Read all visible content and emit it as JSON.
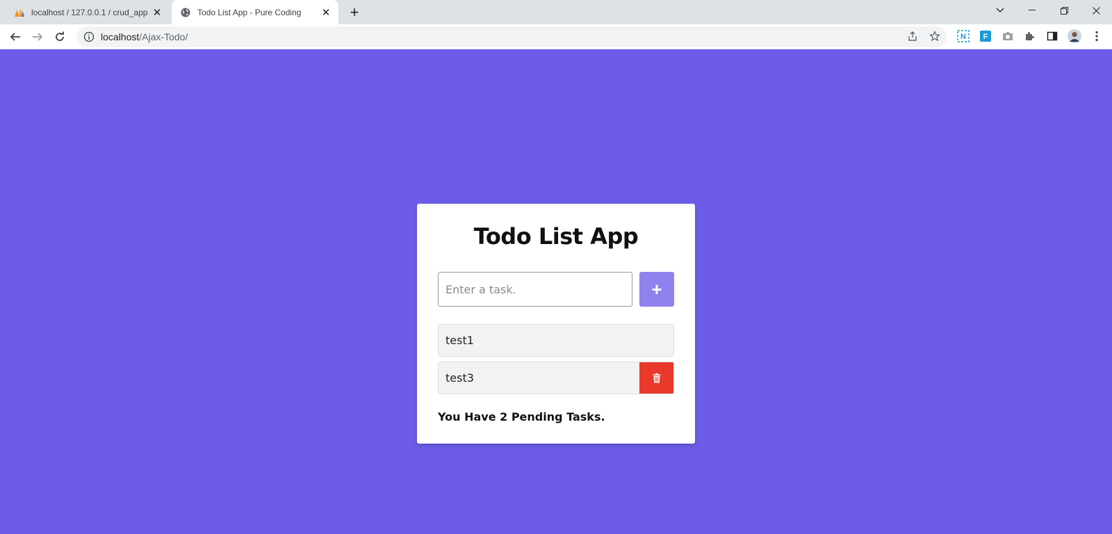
{
  "browser": {
    "tabs": [
      {
        "title": "localhost / 127.0.0.1 / crud_app |",
        "icon": "phpmyadmin-icon",
        "active": false
      },
      {
        "title": "Todo List App - Pure Coding",
        "icon": "globe-icon",
        "active": true
      }
    ],
    "url_host": "localhost",
    "url_path": "/Ajax-Todo/"
  },
  "app": {
    "title": "Todo List App",
    "input_placeholder": "Enter a task.",
    "add_label": "+",
    "todos": [
      {
        "text": "test1"
      },
      {
        "text": "test3"
      }
    ],
    "pending_text": "You Have 2 Pending Tasks."
  },
  "colors": {
    "background": "#6c5ce7",
    "accent_button": "#8e82ef",
    "delete_button": "#e8392b"
  }
}
